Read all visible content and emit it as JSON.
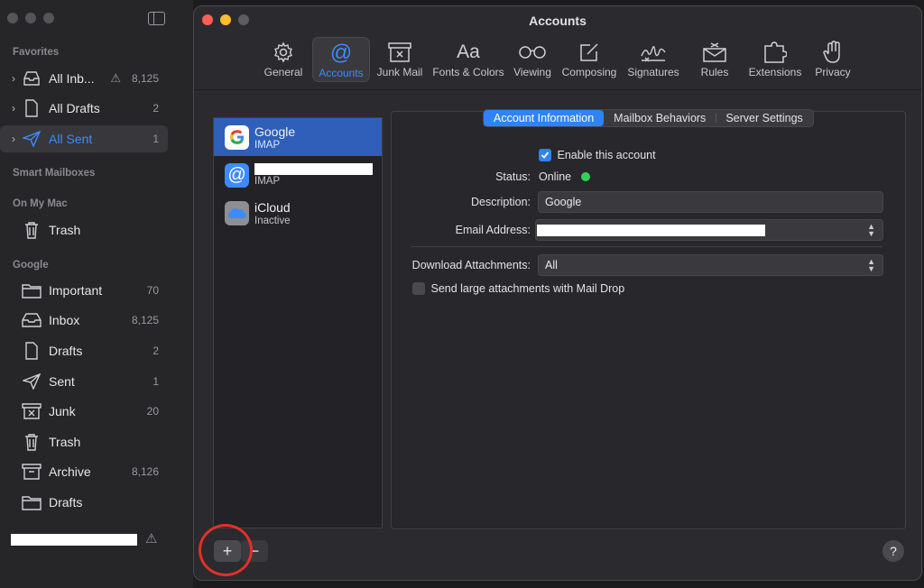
{
  "sidebar": {
    "sections": {
      "favorites": "Favorites",
      "smart": "Smart Mailboxes",
      "onmymac": "On My Mac",
      "google": "Google"
    },
    "favorites": [
      {
        "label": "All Inb...",
        "count": "8,125"
      },
      {
        "label": "All Drafts",
        "count": "2"
      },
      {
        "label": "All Sent",
        "count": "1"
      }
    ],
    "onmymac": [
      {
        "label": "Trash",
        "count": ""
      }
    ],
    "google": [
      {
        "label": "Important",
        "count": "70"
      },
      {
        "label": "Inbox",
        "count": "8,125"
      },
      {
        "label": "Drafts",
        "count": "2"
      },
      {
        "label": "Sent",
        "count": "1"
      },
      {
        "label": "Junk",
        "count": "20"
      },
      {
        "label": "Trash",
        "count": ""
      },
      {
        "label": "Archive",
        "count": "8,126"
      },
      {
        "label": "Drafts",
        "count": ""
      }
    ]
  },
  "window": {
    "title": "Accounts",
    "toolbar": [
      {
        "label": "General",
        "icon": "gear-icon"
      },
      {
        "label": "Accounts",
        "icon": "at-icon"
      },
      {
        "label": "Junk Mail",
        "icon": "junk-icon"
      },
      {
        "label": "Fonts & Colors",
        "icon": "fonts-icon"
      },
      {
        "label": "Viewing",
        "icon": "glasses-icon"
      },
      {
        "label": "Composing",
        "icon": "compose-icon"
      },
      {
        "label": "Signatures",
        "icon": "signature-icon"
      },
      {
        "label": "Rules",
        "icon": "rules-icon"
      },
      {
        "label": "Extensions",
        "icon": "puzzle-icon"
      },
      {
        "label": "Privacy",
        "icon": "hand-icon"
      }
    ],
    "accounts": [
      {
        "name": "Google",
        "type": "IMAP"
      },
      {
        "name": "",
        "type": "IMAP"
      },
      {
        "name": "iCloud",
        "type": "Inactive"
      }
    ],
    "tabs": [
      "Account Information",
      "Mailbox Behaviors",
      "Server Settings"
    ],
    "form": {
      "enable_label": "Enable this account",
      "status_label": "Status:",
      "status_value": "Online",
      "description_label": "Description:",
      "description_value": "Google",
      "email_label": "Email Address:",
      "download_label": "Download Attachments:",
      "download_value": "All",
      "maildrop_label": "Send large attachments with Mail Drop"
    },
    "buttons": {
      "add": "+",
      "remove": "−",
      "help": "?"
    }
  },
  "colors": {
    "accent": "#2f83f6",
    "online": "#30d158",
    "annotation": "#e0312a"
  }
}
